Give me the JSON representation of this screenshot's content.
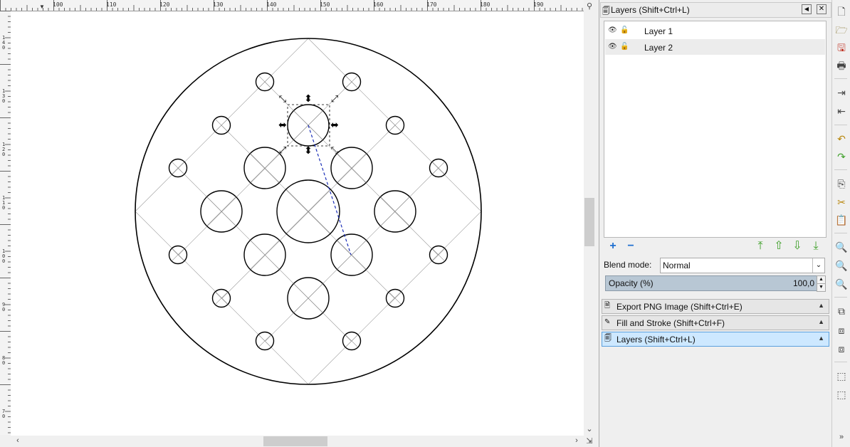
{
  "ruler": {
    "top_labels": [
      "100",
      "110",
      "120",
      "130",
      "140",
      "150",
      "160",
      "170",
      "180",
      "190"
    ],
    "left_labels": [
      "1\n4\n0",
      "1\n3\n0",
      "1\n2\n0",
      "1\n1\n0",
      "1\n0\n0",
      "9\n0",
      "8\n0",
      "7\n0"
    ]
  },
  "layers_panel": {
    "title": "Layers (Shift+Ctrl+L)",
    "layers": [
      {
        "name": "Layer 1"
      },
      {
        "name": "Layer 2"
      }
    ],
    "blend_label": "Blend mode:",
    "blend_value": "Normal",
    "opacity_label": "Opacity (%)",
    "opacity_value": "100,0"
  },
  "docked": [
    {
      "label": "Export PNG Image (Shift+Ctrl+E)",
      "icon": "export-icon"
    },
    {
      "label": "Fill and Stroke (Shift+Ctrl+F)",
      "icon": "fill-stroke-icon"
    },
    {
      "label": "Layers (Shift+Ctrl+L)",
      "icon": "layers-icon"
    }
  ],
  "icons": {
    "visible": "eye-icon",
    "lock": "lock-icon",
    "add": "plus-icon",
    "remove": "minus-icon",
    "raise_top": "raise-to-top-icon",
    "raise": "raise-icon",
    "lower": "lower-icon",
    "lower_bottom": "lower-to-bottom-icon"
  },
  "colors": {
    "accent_green": "#3fa02a",
    "guide_blue": "#1b2fb8",
    "selected_dock": "#cde8ff",
    "add_blue": "#1f6fd0"
  }
}
